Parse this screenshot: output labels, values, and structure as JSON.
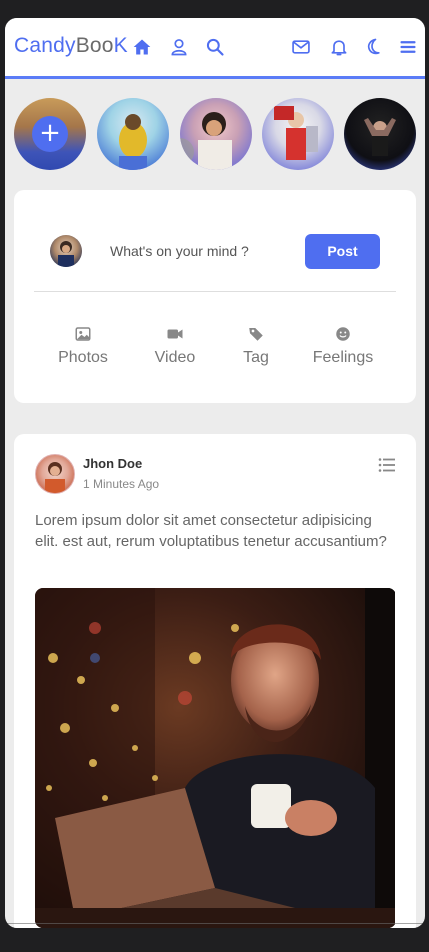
{
  "navbar": {
    "brand_candy": "Candy",
    "brand_boo": "Boo",
    "brand_k": "K",
    "icons": [
      "home-icon",
      "user-icon",
      "search-icon",
      "mail-icon",
      "bell-icon",
      "moon-icon",
      "hamburger-icon"
    ],
    "accent": "#4f6ef0"
  },
  "stories": {
    "add_symbol": "+",
    "count": 5
  },
  "composer": {
    "placeholder": "What's on your mind ?",
    "post_label": "Post",
    "actions": [
      {
        "label": "Photos",
        "icon": "image-icon"
      },
      {
        "label": "Video",
        "icon": "video-icon"
      },
      {
        "label": "Tag",
        "icon": "tag-icon"
      },
      {
        "label": "Feelings",
        "icon": "smile-icon"
      }
    ]
  },
  "post": {
    "author": "Jhon Doe",
    "time": "1 Minutes Ago",
    "text": "Lorem ipsum dolor sit amet consectetur adipisicing elit. est aut, rerum voluptatibus tenetur accusantium?",
    "menu_icon": "list-icon"
  }
}
